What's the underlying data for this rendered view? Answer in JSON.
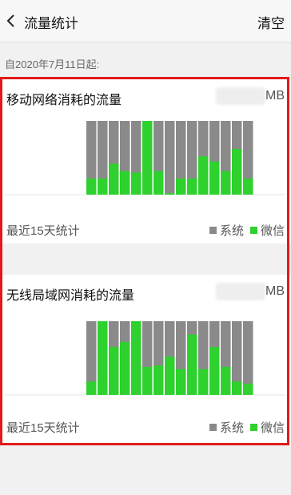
{
  "header": {
    "title": "流量统计",
    "clear_label": "清空"
  },
  "since_label": "自2020年7月11日起:",
  "mobile": {
    "title": "移动网络消耗的流量",
    "unit": "MB",
    "footer": "最近15天统计",
    "legend_system": "系统",
    "legend_wechat": "微信"
  },
  "wifi": {
    "title": "无线局域网消耗的流量",
    "unit": "MB",
    "footer": "最近15天统计",
    "legend_system": "系统",
    "legend_wechat": "微信"
  },
  "colors": {
    "system": "#8a8a8a",
    "wechat": "#2ed12e",
    "highlight": "#e21a1a"
  },
  "chart_data": [
    {
      "type": "bar",
      "title": "移动网络消耗的流量",
      "series": [
        {
          "name": "系统",
          "values": [
            1,
            1,
            1,
            1,
            1,
            1,
            1,
            1,
            1,
            1,
            1,
            1,
            1,
            1,
            1
          ]
        },
        {
          "name": "微信",
          "values": [
            0.22,
            0.22,
            0.42,
            0.32,
            0.3,
            1.0,
            0.32,
            0.02,
            0.22,
            0.22,
            0.52,
            0.45,
            0.32,
            0.62,
            0.22
          ]
        }
      ],
      "ylim": [
        0,
        1
      ]
    },
    {
      "type": "bar",
      "title": "无线局域网消耗的流量",
      "series": [
        {
          "name": "系统",
          "values": [
            1,
            1,
            1,
            1,
            1,
            1,
            1,
            1,
            1,
            1,
            1,
            1,
            1,
            1,
            1
          ]
        },
        {
          "name": "微信",
          "values": [
            0.18,
            1.0,
            0.65,
            0.72,
            1.0,
            0.38,
            0.4,
            0.52,
            0.35,
            0.82,
            0.35,
            0.65,
            0.38,
            0.18,
            0.15
          ]
        }
      ],
      "ylim": [
        0,
        1
      ]
    }
  ]
}
